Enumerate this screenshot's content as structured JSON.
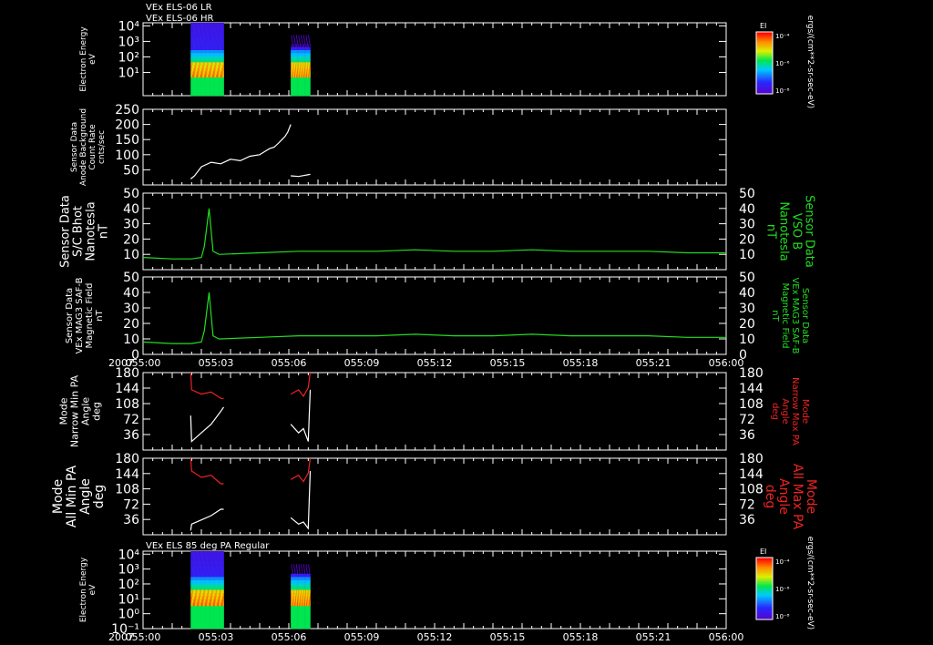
{
  "header": {
    "line1": "VEx ELS-06 LR",
    "line2": "VEx ELS-06 HR"
  },
  "colors": {
    "bg": "#000000",
    "axis": "#ffffff",
    "mag": "#22dd22",
    "red": "#ee2222",
    "white": "#ffffff"
  },
  "colorbar": {
    "title": "EI",
    "ticks": [
      "10⁻⁴",
      "10⁻⁶",
      "10⁻⁸"
    ],
    "unit": "ergs/(cm**2-sr-sec-eV)"
  },
  "time_axis": {
    "year": "2007",
    "ticks": [
      "055:00",
      "055:03",
      "055:06",
      "055:09",
      "055:12",
      "055:15",
      "055:18",
      "055:21",
      "056:00"
    ]
  },
  "panels": [
    {
      "id": "elec_energy_top",
      "type": "heatmap",
      "left_label": [
        "Electron Energy",
        "eV"
      ],
      "y_ticks": [
        "10⁴",
        "10³",
        "10²",
        "10¹"
      ],
      "data_intervals_min": [
        [
          4.9,
          8.3
        ],
        [
          15.2,
          17.2
        ]
      ]
    },
    {
      "id": "anode_count",
      "type": "line",
      "left_label": [
        "Sensor Data",
        "Anode Background",
        "Count Rate",
        "cnts/sec"
      ],
      "ylim": [
        0,
        250
      ],
      "y_ticks": [
        "250",
        "200",
        "150",
        "100",
        "50"
      ]
    },
    {
      "id": "vso_b",
      "type": "line",
      "left_label": [
        "Sensor Data",
        "S/C Bhot",
        "Nanotesla",
        "nT"
      ],
      "right_label": [
        "Sensor Data",
        "VSO B",
        "Nanotesla",
        "nT"
      ],
      "ylim": [
        0,
        50
      ],
      "y_ticks": [
        "50",
        "40",
        "30",
        "20",
        "10"
      ]
    },
    {
      "id": "mag_saf",
      "type": "line",
      "left_label": [
        "Sensor Data",
        "VEx MAG3 SAF-B",
        "Magnetic Field",
        "nT"
      ],
      "right_label": [
        "Sensor Data",
        "VEx MAG3 SAF-B",
        "Magnetic Field",
        "nT"
      ],
      "ylim": [
        0,
        50
      ],
      "y_ticks": [
        "50",
        "40",
        "30",
        "20",
        "10",
        "0"
      ]
    },
    {
      "id": "narrow_pa",
      "type": "line",
      "left_label": [
        "Mode",
        "Narrow Min PA",
        "Angle",
        "deg"
      ],
      "right_label": [
        "Mode",
        "Narrow Max PA",
        "Angle",
        "deg"
      ],
      "ylim": [
        0,
        180
      ],
      "y_ticks": [
        "180",
        "144",
        "108",
        "72",
        "36"
      ]
    },
    {
      "id": "all_pa",
      "type": "line",
      "left_label": [
        "Mode",
        "All Min PA",
        "Angle",
        "deg"
      ],
      "right_label": [
        "Mode",
        "All Max PA",
        "Angle",
        "deg"
      ],
      "ylim": [
        0,
        180
      ],
      "y_ticks": [
        "180",
        "144",
        "108",
        "72",
        "36"
      ]
    },
    {
      "id": "elec_energy_bottom",
      "type": "heatmap",
      "title": "VEx ELS 85 deg PA Regular",
      "left_label": [
        "Electron Energy",
        "eV"
      ],
      "y_ticks": [
        "10⁴",
        "10³",
        "10²",
        "10¹",
        "10⁰",
        "10⁻¹"
      ],
      "data_intervals_min": [
        [
          4.9,
          8.3
        ],
        [
          15.2,
          17.2
        ]
      ]
    }
  ],
  "chart_data": [
    {
      "type": "heatmap",
      "title": "VEx ELS-06 LR / VEx ELS-06 HR",
      "ylabel": "Electron Energy eV",
      "x_range_min": [
        0,
        60
      ],
      "ylim_log10": [
        -0.5,
        4.2
      ],
      "data_intervals_min": [
        [
          4.9,
          8.3
        ],
        [
          15.2,
          17.2
        ]
      ]
    },
    {
      "type": "line",
      "ylabel": "Anode Background Count Rate cnts/sec",
      "ylim": [
        0,
        250
      ],
      "x": [
        4.9,
        5.3,
        6,
        7,
        8,
        9,
        10,
        11,
        12,
        12.5,
        13,
        13.5,
        14,
        14.3,
        14.6,
        14.9,
        15.2,
        15.2,
        16,
        17.2
      ],
      "y": [
        20,
        30,
        60,
        75,
        70,
        85,
        80,
        95,
        100,
        110,
        120,
        125,
        140,
        150,
        160,
        175,
        200,
        30,
        28,
        35
      ]
    },
    {
      "type": "line",
      "title": "S/C Bhot / VSO B",
      "ylabel": "nT",
      "ylim": [
        0,
        50
      ],
      "x": [
        0,
        3,
        5,
        6,
        6.3,
        6.8,
        7.2,
        7.8,
        8,
        12,
        16,
        20,
        24,
        28,
        32,
        36,
        40,
        44,
        48,
        52,
        56,
        60
      ],
      "y": [
        8,
        7,
        7,
        8,
        15,
        40,
        12,
        10,
        10,
        11,
        12,
        12,
        12,
        13,
        12,
        12,
        13,
        12,
        12,
        12,
        11,
        11
      ]
    },
    {
      "type": "line",
      "title": "VEx MAG3 SAF-B",
      "ylabel": "nT",
      "ylim": [
        0,
        50
      ],
      "x": [
        0,
        3,
        5,
        6,
        6.3,
        6.8,
        7.2,
        7.8,
        8,
        12,
        16,
        20,
        24,
        28,
        32,
        36,
        40,
        44,
        48,
        52,
        56,
        60
      ],
      "y": [
        8,
        7,
        7,
        8,
        15,
        40,
        12,
        10,
        10,
        11,
        12,
        12,
        12,
        13,
        12,
        12,
        13,
        12,
        12,
        12,
        11,
        11
      ]
    },
    {
      "type": "line",
      "title": "Narrow PA",
      "ylabel": "deg",
      "ylim": [
        0,
        180
      ],
      "series": [
        {
          "name": "Narrow Max PA",
          "x": [
            4.9,
            5,
            6,
            7,
            8,
            8.3,
            15.2,
            16,
            16.5,
            17,
            17.2
          ],
          "y": [
            180,
            140,
            130,
            135,
            120,
            120,
            130,
            140,
            125,
            145,
            180
          ]
        },
        {
          "name": "Narrow Min PA",
          "x": [
            4.9,
            5,
            6,
            7,
            8,
            8.3,
            15.2,
            16,
            16.5,
            17,
            17.2
          ],
          "y": [
            80,
            20,
            40,
            60,
            90,
            100,
            60,
            40,
            50,
            20,
            140
          ]
        }
      ]
    },
    {
      "type": "line",
      "title": "All PA",
      "ylabel": "deg",
      "ylim": [
        0,
        180
      ],
      "series": [
        {
          "name": "All Max PA",
          "x": [
            4.9,
            5,
            6,
            7,
            8,
            8.3,
            15.2,
            16,
            16.5,
            17,
            17.2
          ],
          "y": [
            180,
            150,
            135,
            140,
            120,
            120,
            130,
            140,
            125,
            145,
            180
          ]
        },
        {
          "name": "All Min PA",
          "x": [
            4.9,
            5,
            6,
            7,
            8,
            8.3,
            15.2,
            16,
            16.5,
            17,
            17.2
          ],
          "y": [
            10,
            25,
            35,
            45,
            60,
            60,
            40,
            25,
            30,
            15,
            150
          ]
        }
      ]
    },
    {
      "type": "heatmap",
      "title": "VEx ELS 85 deg PA Regular",
      "ylabel": "Electron Energy eV",
      "x_range_min": [
        0,
        60
      ],
      "ylim_log10": [
        -1,
        4.2
      ],
      "data_intervals_min": [
        [
          4.9,
          8.3
        ],
        [
          15.2,
          17.2
        ]
      ]
    }
  ]
}
